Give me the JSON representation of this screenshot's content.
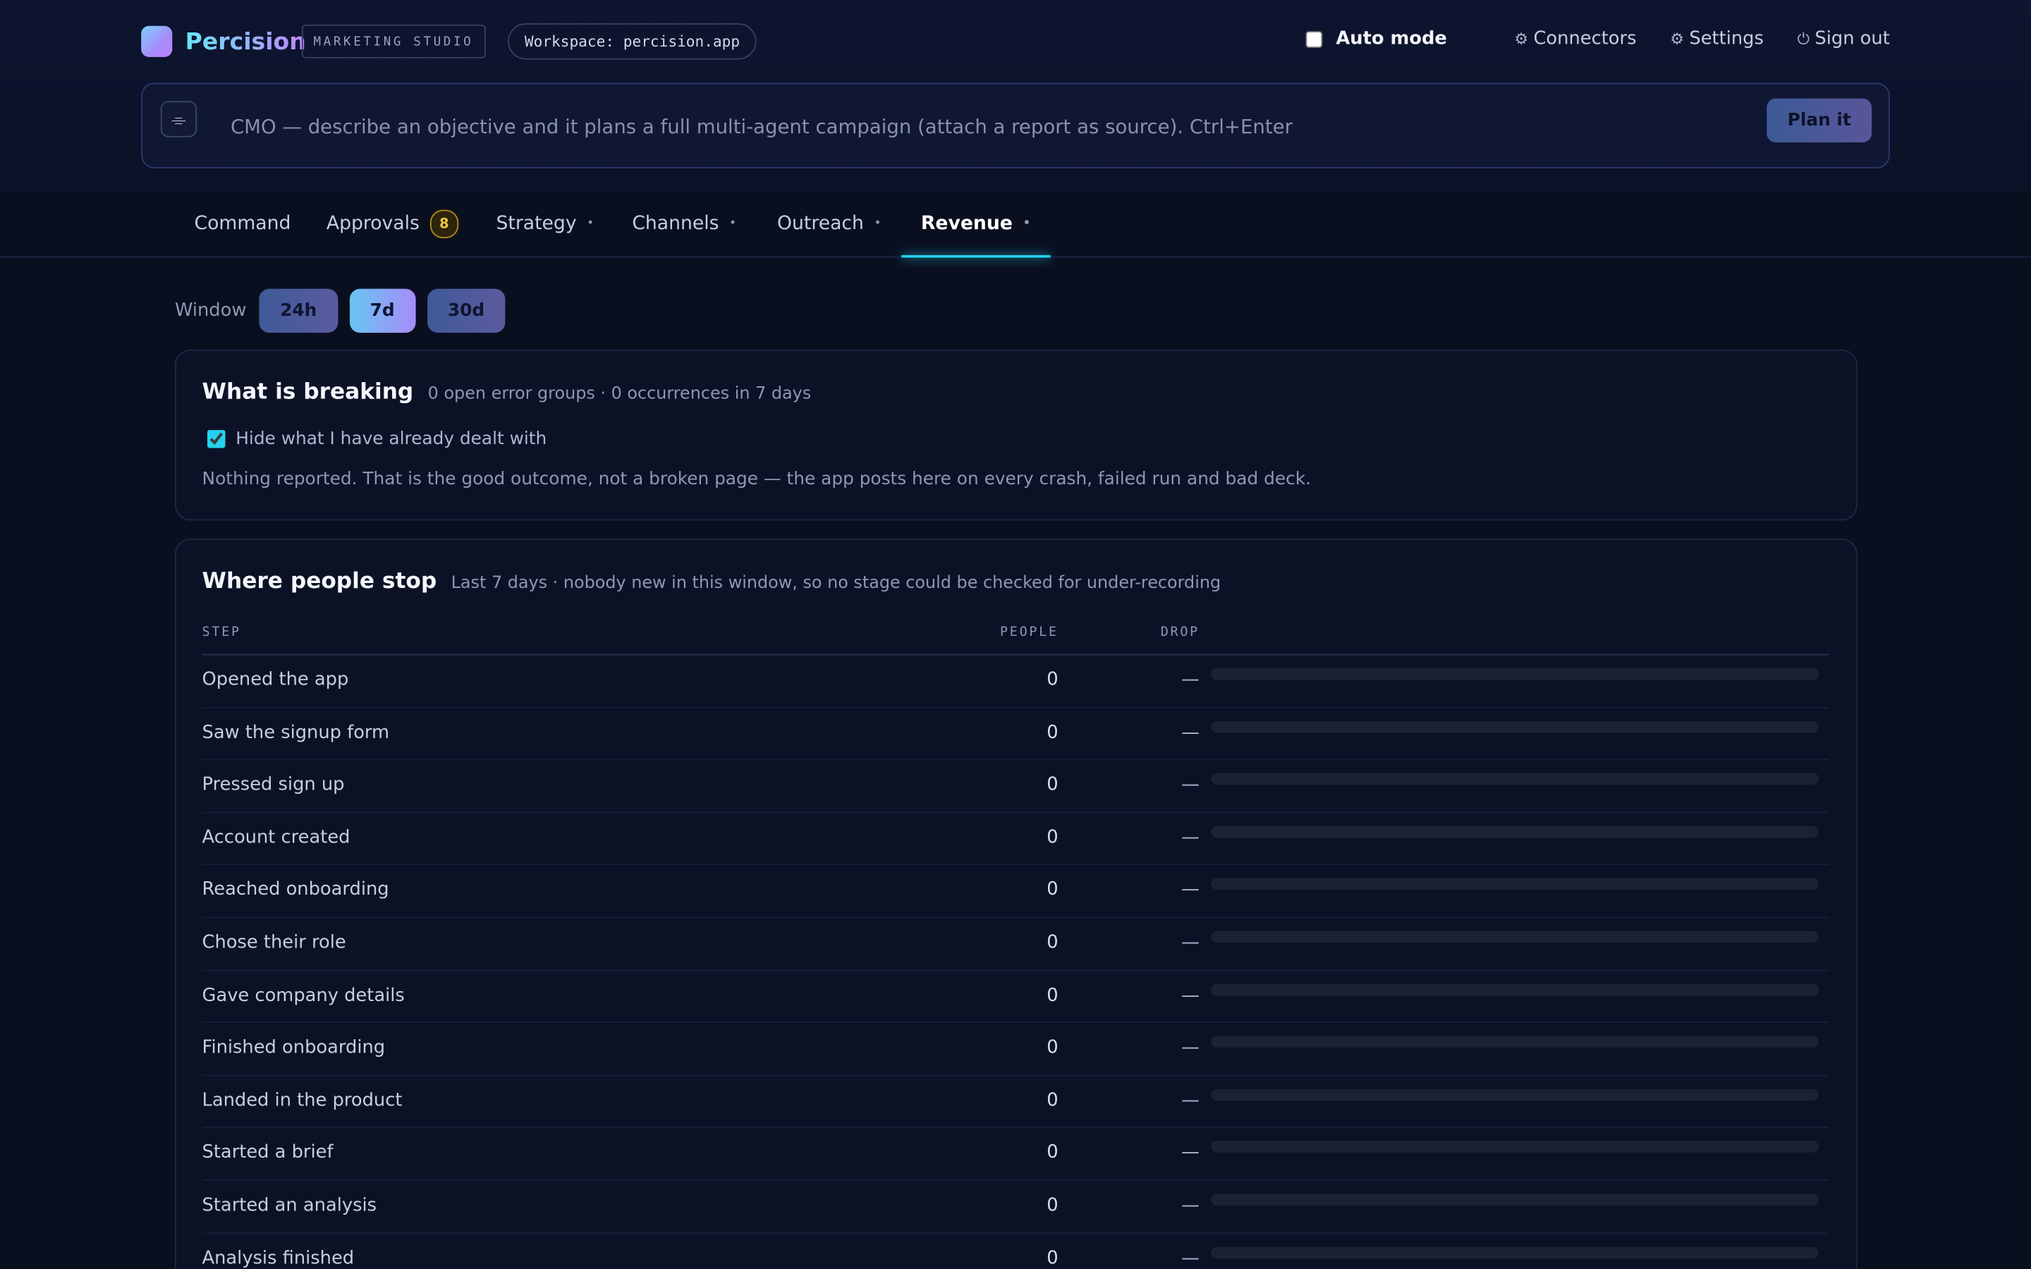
{
  "brand": {
    "name": "Percision",
    "studio": "MARKETING STUDIO",
    "workspace": "Workspace: percision.app"
  },
  "topnav": {
    "auto_mode": "Auto mode",
    "connectors": "Connectors",
    "settings": "Settings",
    "sign_out": "Sign out",
    "icons": {
      "connectors": "gear-icon",
      "settings": "gear-icon",
      "sign_out": "power-icon"
    }
  },
  "command": {
    "placeholder": "CMO — describe an objective and it plans a full multi-agent campaign (attach a report as source). Ctrl+Enter",
    "attach_icon": "paperclip-icon",
    "button": "Plan it"
  },
  "tabs": [
    {
      "label": "Command"
    },
    {
      "label": "Approvals",
      "badge": "8"
    },
    {
      "label": "Strategy",
      "dot": "•"
    },
    {
      "label": "Channels",
      "dot": "•"
    },
    {
      "label": "Outreach",
      "dot": "•"
    },
    {
      "label": "Revenue",
      "dot": "•",
      "active": true
    }
  ],
  "window": {
    "label": "Window",
    "options": [
      "24h",
      "7d",
      "30d"
    ],
    "selected": "7d"
  },
  "breaking": {
    "title": "What is breaking",
    "subtitle": "0 open error groups · 0 occurrences in 7 days",
    "hide_label": "Hide what I have already dealt with",
    "hide_checked": true,
    "empty": "Nothing reported. That is the good outcome, not a broken page — the app posts here on every crash, failed run and bad deck."
  },
  "funnel": {
    "title": "Where people stop",
    "subtitle": "Last 7 days · nobody new in this window, so no stage could be checked for under-recording",
    "columns": {
      "step": "STEP",
      "people": "PEOPLE",
      "drop": "DROP"
    },
    "rows": [
      {
        "step": "Opened the app",
        "people": "0",
        "drop": "—",
        "share": 0
      },
      {
        "step": "Saw the signup form",
        "people": "0",
        "drop": "—",
        "share": 0
      },
      {
        "step": "Pressed sign up",
        "people": "0",
        "drop": "—",
        "share": 0
      },
      {
        "step": "Account created",
        "people": "0",
        "drop": "—",
        "share": 0
      },
      {
        "step": "Reached onboarding",
        "people": "0",
        "drop": "—",
        "share": 0
      },
      {
        "step": "Chose their role",
        "people": "0",
        "drop": "—",
        "share": 0
      },
      {
        "step": "Gave company details",
        "people": "0",
        "drop": "—",
        "share": 0
      },
      {
        "step": "Finished onboarding",
        "people": "0",
        "drop": "—",
        "share": 0
      },
      {
        "step": "Landed in the product",
        "people": "0",
        "drop": "—",
        "share": 0
      },
      {
        "step": "Started a brief",
        "people": "0",
        "drop": "—",
        "share": 0
      },
      {
        "step": "Started an analysis",
        "people": "0",
        "drop": "—",
        "share": 0
      },
      {
        "step": "Analysis finished",
        "people": "0",
        "drop": "—",
        "share": 0
      }
    ]
  }
}
